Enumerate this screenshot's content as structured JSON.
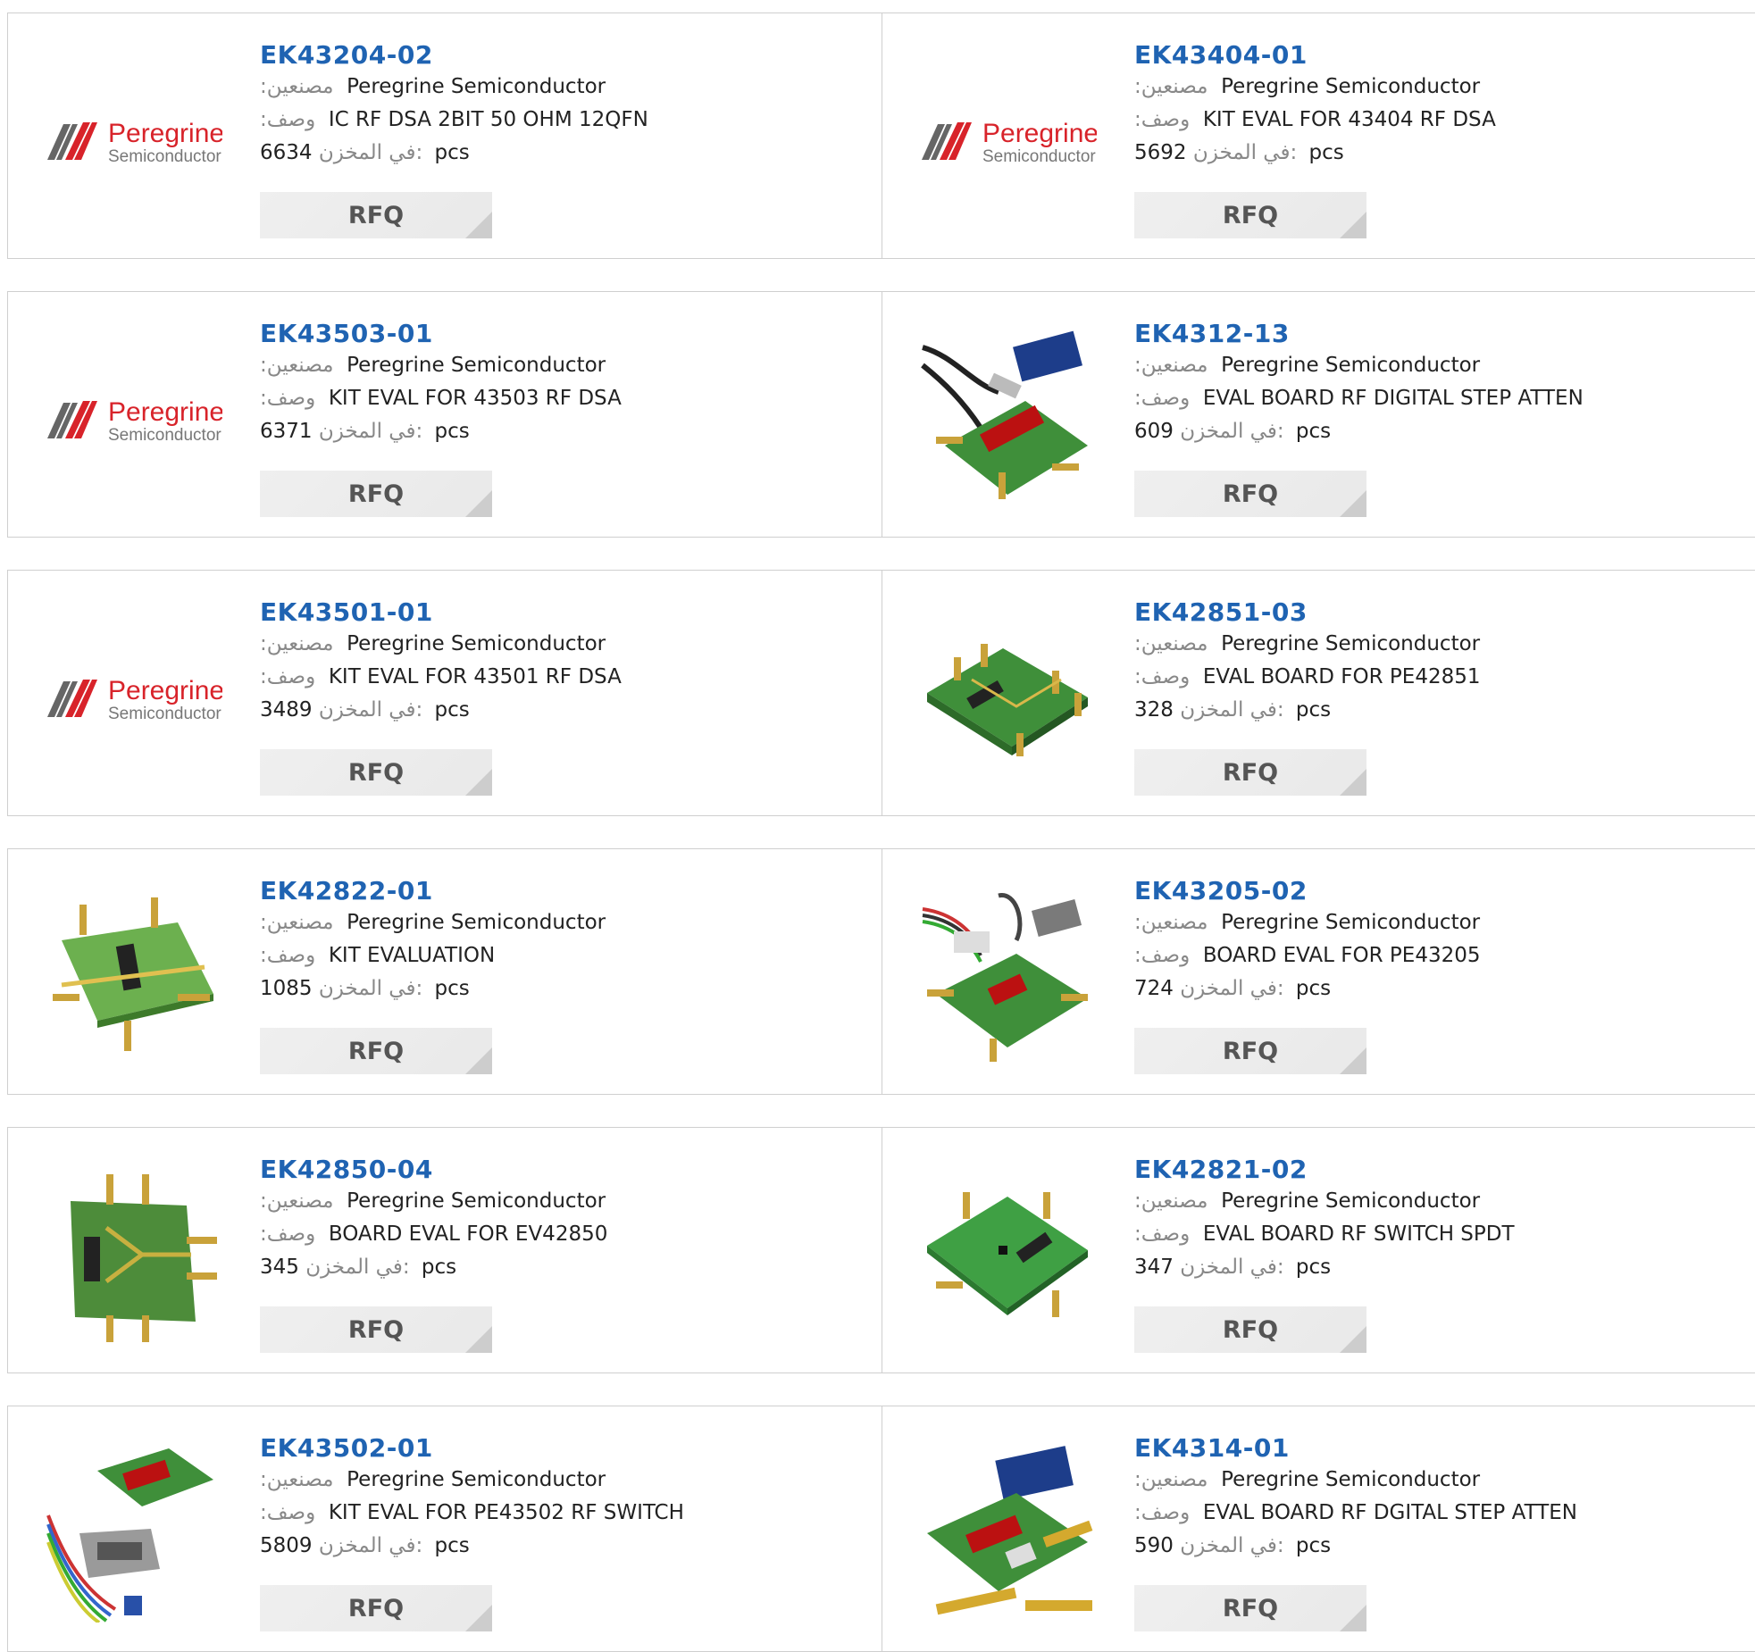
{
  "labels": {
    "manufacturer": ":مصنعين",
    "description": ":وصف",
    "stock": "في المخزن:",
    "pcs": "pcs",
    "rfq": "RFQ"
  },
  "logo": {
    "line1": "Peregrine",
    "line2": "Semiconductor",
    "brand_color": "#d8232a"
  },
  "products": [
    {
      "pn": "EK43204-02",
      "manufacturer": "Peregrine Semiconductor",
      "description": "IC RF DSA 2BIT 50 OHM 12QFN",
      "stock": "6634",
      "image": "peregrine-logo"
    },
    {
      "pn": "EK43404-01",
      "manufacturer": "Peregrine Semiconductor",
      "description": "KIT EVAL FOR 43404 RF DSA",
      "stock": "5692",
      "image": "peregrine-logo"
    },
    {
      "pn": "EK43503-01",
      "manufacturer": "Peregrine Semiconductor",
      "description": "KIT EVAL FOR 43503 RF DSA",
      "stock": "6371",
      "image": "peregrine-logo"
    },
    {
      "pn": "EK4312-13",
      "manufacturer": "Peregrine Semiconductor",
      "description": "EVAL BOARD RF DIGITAL STEP ATTEN",
      "stock": "609",
      "image": "eval-board-usb"
    },
    {
      "pn": "EK43501-01",
      "manufacturer": "Peregrine Semiconductor",
      "description": "KIT EVAL FOR 43501 RF DSA",
      "stock": "3489",
      "image": "peregrine-logo"
    },
    {
      "pn": "EK42851-03",
      "manufacturer": "Peregrine Semiconductor",
      "description": "EVAL BOARD FOR PE42851",
      "stock": "328",
      "image": "eval-board"
    },
    {
      "pn": "EK42822-01",
      "manufacturer": "Peregrine Semiconductor",
      "description": "KIT EVALUATION",
      "stock": "1085",
      "image": "eval-board"
    },
    {
      "pn": "EK43205-02",
      "manufacturer": "Peregrine Semiconductor",
      "description": "BOARD EVAL FOR PE43205",
      "stock": "724",
      "image": "eval-board-cable"
    },
    {
      "pn": "EK42850-04",
      "manufacturer": "Peregrine Semiconductor",
      "description": "BOARD EVAL FOR EV42850",
      "stock": "345",
      "image": "eval-board"
    },
    {
      "pn": "EK42821-02",
      "manufacturer": "Peregrine Semiconductor",
      "description": "EVAL BOARD RF SWITCH SPDT",
      "stock": "347",
      "image": "eval-board"
    },
    {
      "pn": "EK43502-01",
      "manufacturer": "Peregrine Semiconductor",
      "description": "KIT EVAL FOR PE43502 RF SWITCH",
      "stock": "5809",
      "image": "eval-board-cable"
    },
    {
      "pn": "EK4314-01",
      "manufacturer": "Peregrine Semiconductor",
      "description": "EVAL BOARD RF DGITAL STEP ATTEN",
      "stock": "590",
      "image": "eval-board-usb"
    }
  ]
}
